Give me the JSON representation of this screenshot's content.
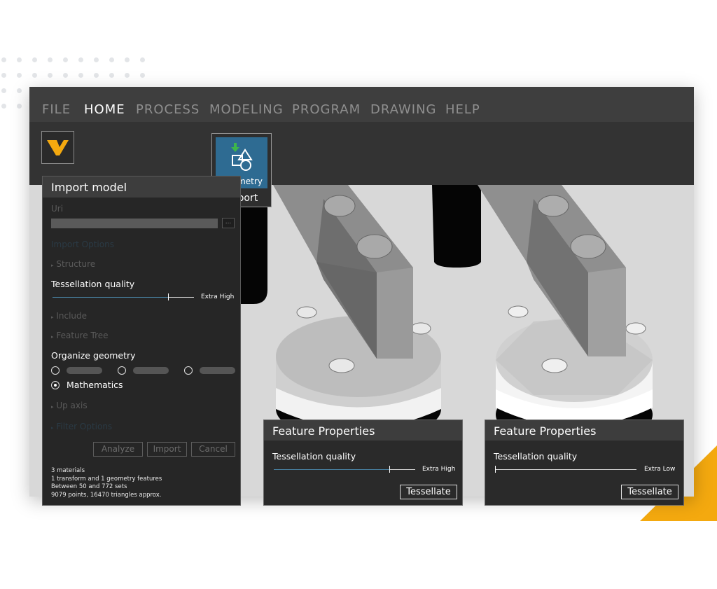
{
  "menu": {
    "items": [
      "FILE",
      "HOME",
      "PROCESS",
      "MODELING",
      "PROGRAM",
      "DRAWING",
      "HELP"
    ],
    "active": "HOME"
  },
  "toolbar": {
    "geometry_label": "Geometry",
    "import_label": "Import"
  },
  "import_panel": {
    "title": "Import model",
    "uri_label": "Uri",
    "browse_label": "...",
    "import_options_label": "Import Options",
    "structure_label": "Structure",
    "tessellation_label": "Tessellation quality",
    "tessellation_value": "Extra High",
    "tessellation_level": 0.8,
    "include_label": "Include",
    "feature_tree_label": "Feature Tree",
    "organize_label": "Organize geometry",
    "organize_option_selected": "Mathematics",
    "up_axis_label": "Up axis",
    "filter_options_label": "Filter Options",
    "buttons": {
      "analyze": "Analyze",
      "import": "Import",
      "cancel": "Cancel"
    },
    "stats": [
      "3 materials",
      "1 transform and 1 geometry features",
      "Between 50 and 772 sets",
      "9079 points, 16470 triangles approx."
    ]
  },
  "feature_props_left": {
    "title": "Feature Properties",
    "tessellation_label": "Tessellation quality",
    "tessellation_value": "Extra High",
    "tessellation_level": 0.8,
    "button": "Tessellate"
  },
  "feature_props_right": {
    "title": "Feature Properties",
    "tessellation_label": "Tessellation quality",
    "tessellation_value": "Extra Low",
    "tessellation_level": 0.0,
    "button": "Tessellate"
  },
  "colors": {
    "accent": "#f4a90f",
    "slider_blue": "#4a86a8",
    "geometry_tile": "#2e6b92",
    "download_green": "#3db64a"
  }
}
